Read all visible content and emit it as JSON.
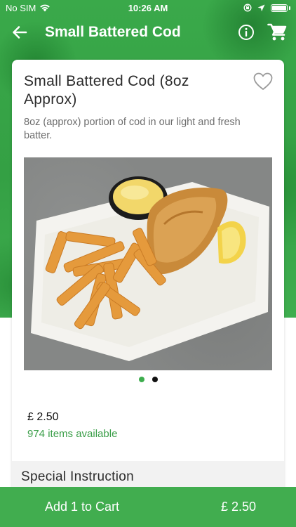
{
  "status_bar": {
    "carrier": "No SIM",
    "time": "10:26 AM"
  },
  "nav": {
    "title": "Small Battered Cod"
  },
  "product": {
    "name": "Small Battered Cod (8oz Approx)",
    "description": "8oz (approx) portion of cod in our light and fresh batter.",
    "price": "£ 2.50",
    "availability": "974 items available"
  },
  "carousel": {
    "total": 2,
    "active_index": 0
  },
  "special_instruction": {
    "title": "Special Instruction"
  },
  "cart_bar": {
    "label": "Add 1 to Cart",
    "price": "£ 2.50"
  },
  "colors": {
    "brand_green": "#41ad4f",
    "availability_green": "#3a9e48",
    "dot_inactive": "#111111"
  },
  "icons": {
    "back": "arrow-left-icon",
    "info": "info-icon",
    "cart": "cart-icon",
    "favorite": "heart-outline-icon",
    "wifi": "wifi-icon",
    "location": "location-arrow-icon",
    "lock_rotation": "rotation-lock-icon",
    "battery": "battery-icon"
  }
}
